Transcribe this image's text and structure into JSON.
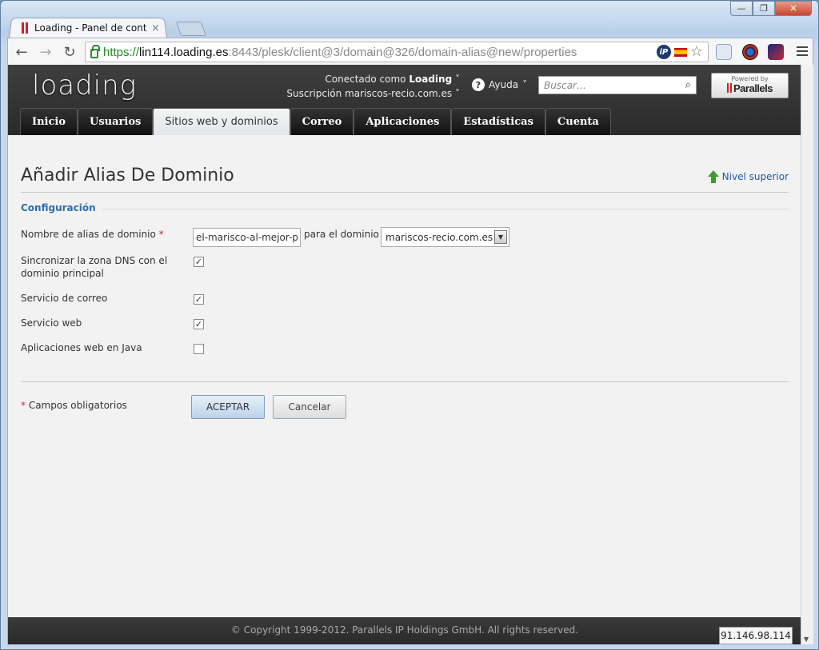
{
  "browser": {
    "tab_title": "Loading - Panel de control",
    "tab_close": "×",
    "url_scheme": "https://",
    "url_host": "lin114.loading.es",
    "url_path": ":8443/plesk/client@3/domain@326/domain-alias@new/properties",
    "ip_badge": "iP",
    "star": "☆",
    "win_min": "—",
    "win_max": "❐",
    "win_close": "✕",
    "back": "←",
    "forward": "→",
    "reload": "↻"
  },
  "header": {
    "logo": "loading",
    "logged_in_prefix": "Conectado como",
    "logged_in_user": "Loading",
    "subscription_prefix": "Suscripción",
    "subscription_name": "mariscos-recio.com.es",
    "help": "Ayuda",
    "search_placeholder": "Buscar…",
    "powered_by": "Powered by",
    "parallels": "Parallels"
  },
  "nav": {
    "items": [
      "Inicio",
      "Usuarios",
      "Sitios web y dominios",
      "Correo",
      "Aplicaciones",
      "Estadísticas",
      "Cuenta"
    ],
    "active_index": 2
  },
  "main": {
    "title": "Añadir Alias De Dominio",
    "up_link": "Nivel superior",
    "section_legend": "Configuración",
    "alias_label": "Nombre de alias de dominio",
    "required_mark": "*",
    "alias_value": "el-marisco-al-mejor-p",
    "for_domain_label": "para el dominio",
    "domain_select_value": "mariscos-recio.com.es",
    "dns_sync_label": "Sincronizar la zona DNS con el dominio principal",
    "dns_sync_checked": true,
    "mail_label": "Servicio de correo",
    "mail_checked": true,
    "web_label": "Servicio web",
    "web_checked": true,
    "java_label": "Aplicaciones web en Java",
    "java_checked": false,
    "required_note": "Campos obligatorios",
    "ok_button": "ACEPTAR",
    "cancel_button": "Cancelar"
  },
  "footer": {
    "copyright": "© Copyright 1999-2012. Parallels IP Holdings GmbH. All rights reserved.",
    "ip": "91.146.98.114"
  },
  "colors": {
    "link": "#1d58a6",
    "legend": "#2c6db0",
    "required": "#d0202a",
    "header_bg": "#2f2f2f"
  }
}
